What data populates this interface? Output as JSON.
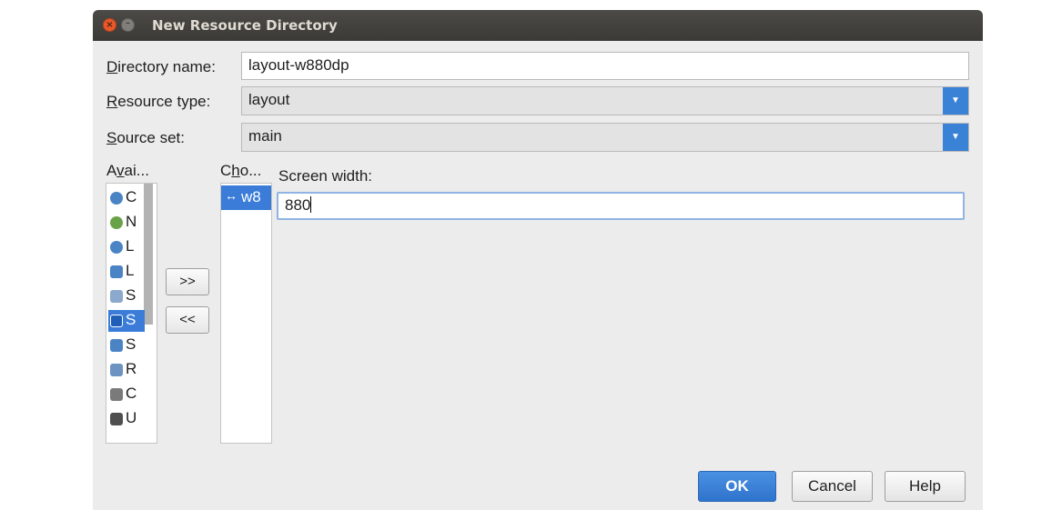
{
  "window": {
    "title": "New Resource Directory",
    "close_glyph": "×",
    "minimize_glyph": "–"
  },
  "form": {
    "directory_name": {
      "label_u": "D",
      "label_rest": "irectory name:",
      "value": "layout-w880dp"
    },
    "resource_type": {
      "label_u": "R",
      "label_rest": "esource type:",
      "value": "layout"
    },
    "source_set": {
      "label_u": "S",
      "label_rest": "ource set:",
      "value": "main"
    }
  },
  "available": {
    "header_a": "A",
    "header_u": "v",
    "header_rest": "ai...",
    "items": [
      {
        "label": "C",
        "icon": "globe-cog-icon",
        "color": "#4a84c4"
      },
      {
        "label": "N",
        "icon": "globe-network-icon",
        "color": "#6aa24a"
      },
      {
        "label": "L",
        "icon": "globe-icon",
        "color": "#4a84c4"
      },
      {
        "label": "L",
        "icon": "layout-direction-icon",
        "color": "#4a84c4"
      },
      {
        "label": "S",
        "icon": "smallest-width-icon",
        "color": "#8aa9cc"
      },
      {
        "label": "S",
        "icon": "screen-height-icon",
        "color": "#3a7cd8"
      },
      {
        "label": "S",
        "icon": "screen-size-icon",
        "color": "#4a84c4"
      },
      {
        "label": "R",
        "icon": "ratio-icon",
        "color": "#6d93c0"
      },
      {
        "label": "C",
        "icon": "orientation-icon",
        "color": "#7a7a7a"
      },
      {
        "label": "U",
        "icon": "ui-mode-icon",
        "color": "#4f4f4f"
      }
    ]
  },
  "transfer": {
    "add_label": ">>",
    "remove_label": "<<"
  },
  "chosen": {
    "header_pre": "C",
    "header_u": "h",
    "header_rest": "o...",
    "item_label": "w8",
    "item_icon": "screen-width-icon"
  },
  "qualifier": {
    "label": "Screen width:",
    "value": "880"
  },
  "buttons": {
    "ok": "OK",
    "cancel": "Cancel",
    "help": "Help"
  },
  "colors": {
    "accent": "#3a7cd8",
    "titlebar": "#3c3b37",
    "dialog_bg": "#ececec"
  }
}
